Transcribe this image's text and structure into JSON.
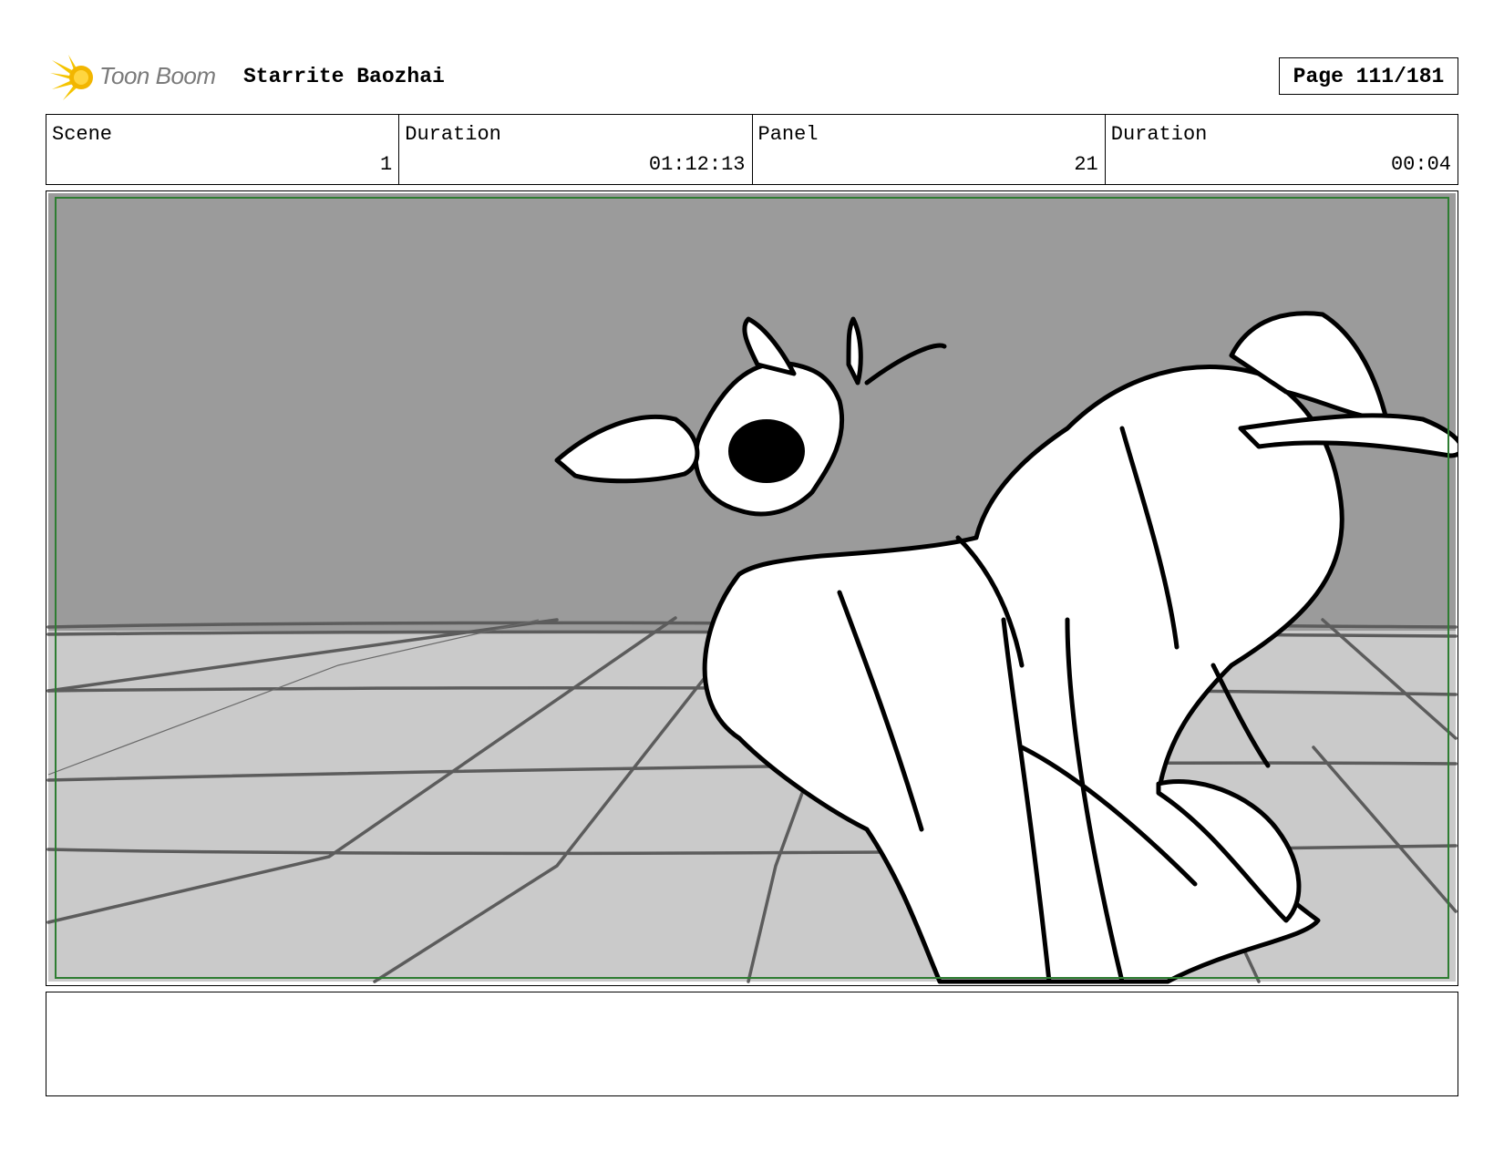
{
  "header": {
    "logo_text": "Toon Boom",
    "logo_icon": "toon-boom-star-icon",
    "project_title": "Starrite Baozhai",
    "page_label": "Page 111/181"
  },
  "info": [
    {
      "label": "Scene",
      "value": "1"
    },
    {
      "label": "Duration",
      "value": "01:12:13"
    },
    {
      "label": "Panel",
      "value": "21"
    },
    {
      "label": "Duration",
      "value": "00:04"
    }
  ],
  "panel": {
    "description": "",
    "colors": {
      "wall": "#9b9b9b",
      "floor": "#cacaca",
      "grid": "#5c5c5c",
      "safe_frame": "#2e7d32",
      "ink": "#000000"
    }
  },
  "notes": {
    "text": ""
  }
}
